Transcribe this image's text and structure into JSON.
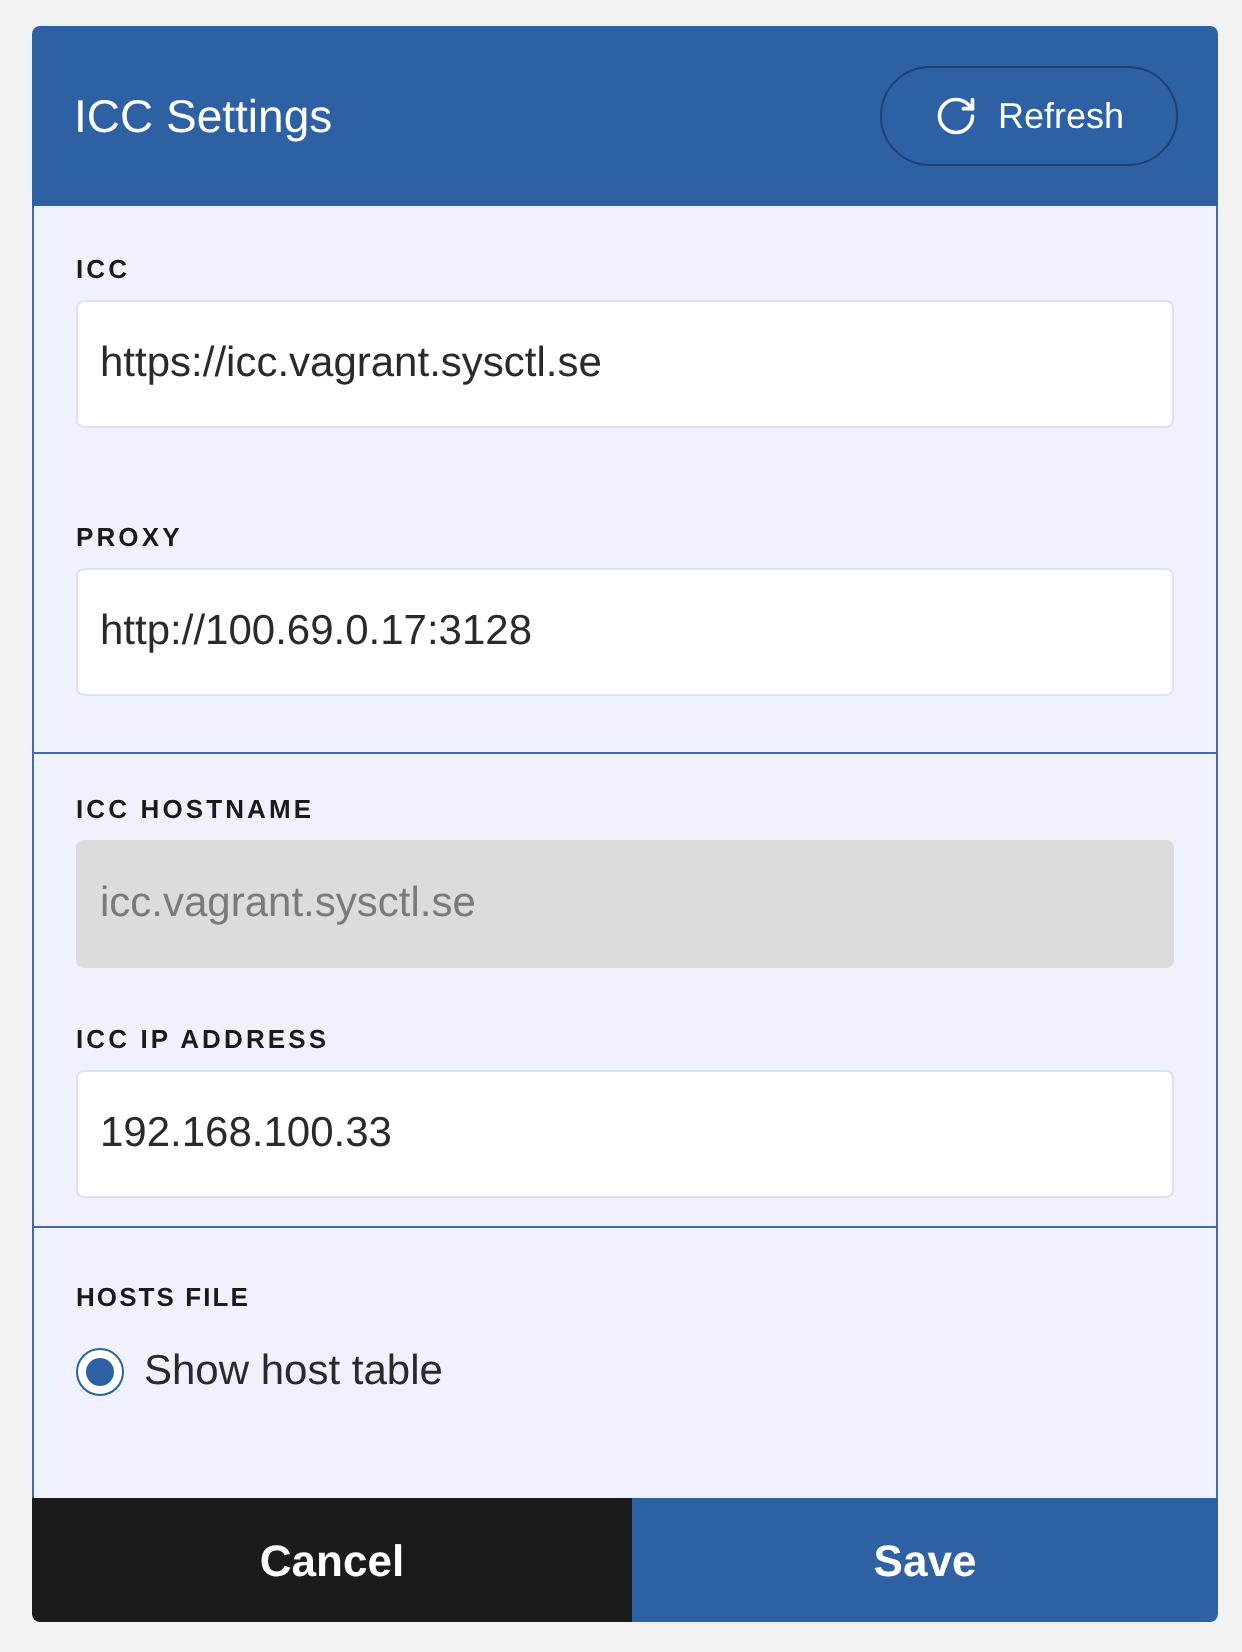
{
  "panel": {
    "title": "ICC Settings",
    "refresh_button": {
      "label": "Refresh"
    }
  },
  "sections": [
    {
      "kind": "fields",
      "fields": [
        {
          "label": "ICC",
          "value": "https://icc.vagrant.sysctl.se",
          "disabled": false
        },
        {
          "label": "PROXY",
          "value": "http://100.69.0.17:3128",
          "disabled": false
        }
      ]
    },
    {
      "kind": "fields",
      "fields": [
        {
          "label": "ICC HOSTNAME",
          "value": "icc.vagrant.sysctl.se",
          "disabled": true
        },
        {
          "label": "ICC IP ADDRESS",
          "value": "192.168.100.33",
          "disabled": false
        }
      ]
    },
    {
      "kind": "radio",
      "title": "HOSTS FILE",
      "options": [
        {
          "label": "Show host table",
          "selected": true
        }
      ]
    }
  ],
  "buttons": [
    {
      "label": "Cancel",
      "kind": "cancel"
    },
    {
      "label": "Save",
      "kind": "save"
    }
  ]
}
